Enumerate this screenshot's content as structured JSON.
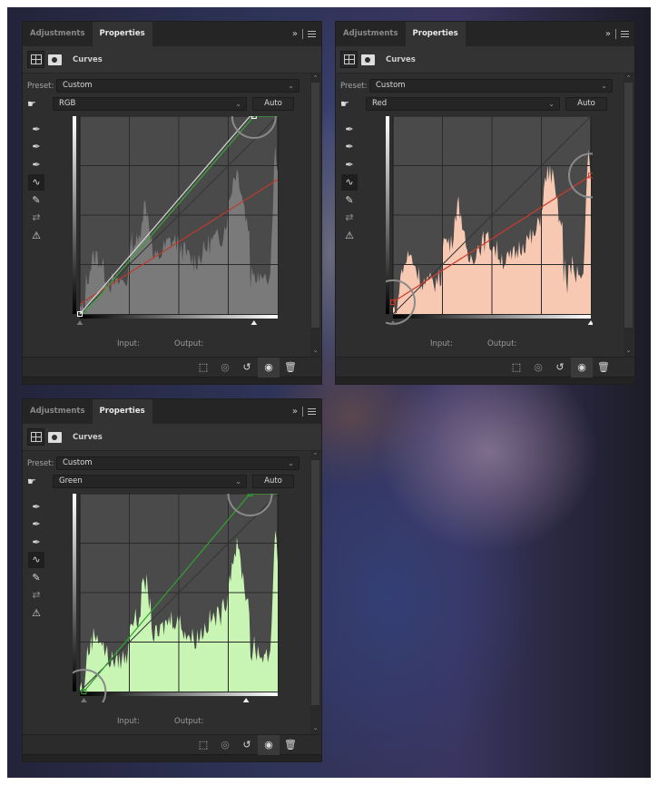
{
  "panels": [
    {
      "id": "rgb",
      "tabs": [
        {
          "label": "Adjustments"
        },
        {
          "label": "Properties",
          "active": true
        }
      ],
      "collapse_glyph": "»",
      "header_title": "Curves",
      "preset_label": "Preset:",
      "preset_value": "Custom",
      "channel": "RGB",
      "auto_label": "Auto",
      "input_label": "Input:",
      "output_label": "Output:",
      "histogram_color": "#7a7a7a",
      "curves": [
        {
          "name": "red",
          "color": "#c0392b",
          "points": [
            [
              0,
              0.05
            ],
            [
              1,
              0.68
            ]
          ]
        },
        {
          "name": "green",
          "color": "#3aa33a",
          "points": [
            [
              0.02,
              0
            ],
            [
              0.88,
              1
            ],
            [
              1,
              1
            ]
          ]
        },
        {
          "name": "composite",
          "color": "#d8d8d8",
          "points": [
            [
              0,
              0
            ],
            [
              0.86,
              1
            ],
            [
              0.88,
              1
            ]
          ]
        }
      ],
      "control_points": [
        [
          0,
          0
        ],
        [
          0.88,
          1
        ]
      ],
      "highlight_circles": [
        [
          0.88,
          1
        ]
      ],
      "white_slider": 0.88,
      "black_slider": 0.0
    },
    {
      "id": "red",
      "tabs": [
        {
          "label": "Adjustments"
        },
        {
          "label": "Properties",
          "active": true
        }
      ],
      "collapse_glyph": "»",
      "header_title": "Curves",
      "preset_label": "Preset:",
      "preset_value": "Custom",
      "channel": "Red",
      "auto_label": "Auto",
      "input_label": "Input:",
      "output_label": "Output:",
      "histogram_color": "#f7c9b3",
      "curves": [
        {
          "name": "red",
          "color": "#d03a2a",
          "points": [
            [
              0,
              0.06
            ],
            [
              1,
              0.7
            ]
          ]
        }
      ],
      "control_points": [
        [
          0,
          0.06
        ],
        [
          1,
          0.7
        ]
      ],
      "highlight_circles": [
        [
          0,
          0.06
        ],
        [
          1,
          0.7
        ]
      ],
      "white_slider": 1.0,
      "black_slider": 0.0
    },
    {
      "id": "green",
      "tabs": [
        {
          "label": "Adjustments"
        },
        {
          "label": "Properties",
          "active": true
        }
      ],
      "collapse_glyph": "»",
      "header_title": "Curves",
      "preset_label": "Preset:",
      "preset_value": "Custom",
      "channel": "Green",
      "auto_label": "Auto",
      "input_label": "Input:",
      "output_label": "Output:",
      "histogram_color": "#c8f5b4",
      "curves": [
        {
          "name": "green",
          "color": "#2fa32f",
          "points": [
            [
              0.02,
              0
            ],
            [
              0.86,
              1
            ],
            [
              1,
              1
            ]
          ]
        }
      ],
      "control_points": [
        [
          0.02,
          0
        ],
        [
          0.86,
          1
        ]
      ],
      "highlight_circles": [
        [
          0.02,
          0
        ],
        [
          0.86,
          1
        ]
      ],
      "white_slider": 0.84,
      "black_slider": 0.02
    }
  ],
  "tools": [
    "eyedropper-black-icon",
    "eyedropper-gray-icon",
    "eyedropper-white-icon",
    "curve-tool-icon",
    "pencil-icon",
    "smooth-icon",
    "clipping-warning-icon"
  ],
  "footer_icons": [
    "clip-to-layer-icon",
    "view-previous-icon",
    "reset-icon",
    "visibility-icon",
    "delete-icon"
  ]
}
